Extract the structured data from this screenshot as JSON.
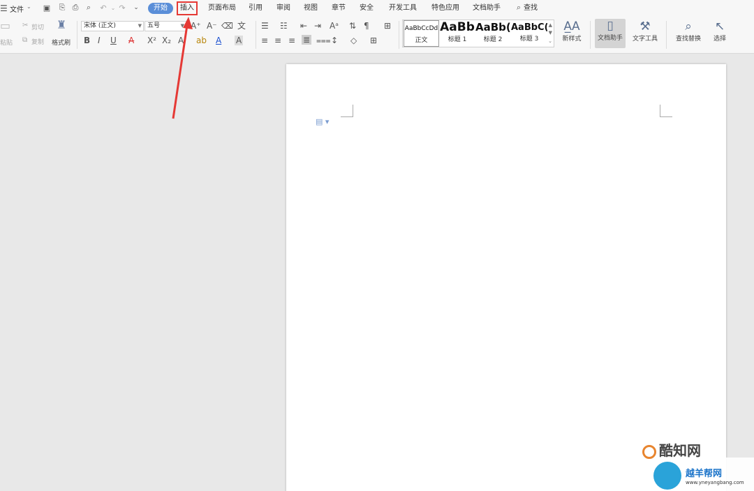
{
  "menubar": {
    "file_label": "文件",
    "tabs": [
      {
        "label": "开始",
        "state": "active"
      },
      {
        "label": "插入",
        "state": "highlighted"
      },
      {
        "label": "页面布局"
      },
      {
        "label": "引用"
      },
      {
        "label": "审阅"
      },
      {
        "label": "视图"
      },
      {
        "label": "章节"
      },
      {
        "label": "安全"
      },
      {
        "label": "开发工具"
      },
      {
        "label": "特色应用"
      },
      {
        "label": "文档助手"
      }
    ],
    "search_label": "查找"
  },
  "ribbon": {
    "clipboard": {
      "paste": "粘贴",
      "cut": "剪切",
      "copy": "复制",
      "format_painter": "格式刷"
    },
    "font": {
      "family": "宋体 (正文)",
      "size": "五号"
    },
    "styles": [
      {
        "sample": "AaBbCcDd",
        "label": "正文"
      },
      {
        "sample": "AaBb",
        "label": "标题 1"
      },
      {
        "sample": "AaBb(",
        "label": "标题 2"
      },
      {
        "sample": "AaBbC(",
        "label": "标题 3"
      }
    ],
    "new_style": "新样式",
    "doc_assistant": "文档助手",
    "text_tools": "文字工具",
    "find_replace": "查找替换",
    "select": "选择"
  },
  "watermarks": {
    "kuzhi": "酷知网",
    "yueyang": "越羊帮网",
    "yueyang_url": "www.yneyangbang.com"
  },
  "colors": {
    "active_tab": "#5a8ed8",
    "highlight_box": "#e53935",
    "arrow": "#e53935"
  }
}
